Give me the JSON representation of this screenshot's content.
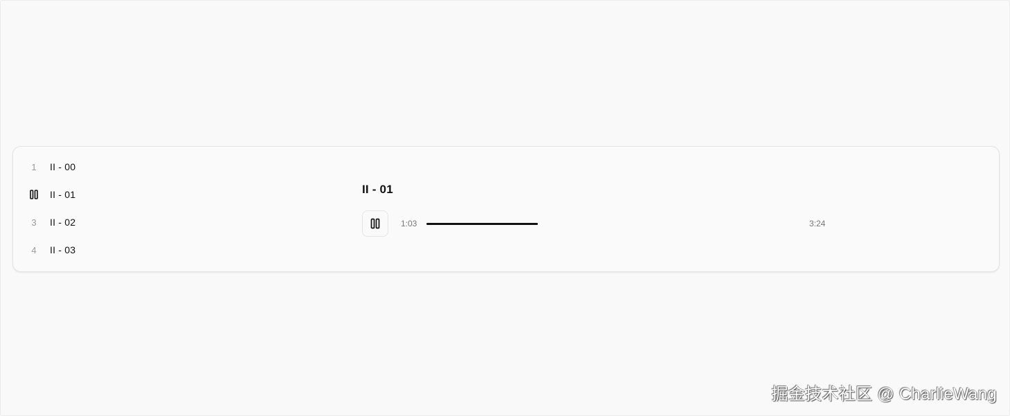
{
  "playlist": {
    "tracks": [
      {
        "number": "1",
        "title": "II - 00",
        "playing": false
      },
      {
        "number": "2",
        "title": "II - 01",
        "playing": true
      },
      {
        "number": "3",
        "title": "II - 02",
        "playing": false
      },
      {
        "number": "4",
        "title": "II - 03",
        "playing": false
      }
    ]
  },
  "now_playing": {
    "title": "II - 01",
    "current_time": "1:03",
    "total_time": "3:24",
    "progress": 0.3088,
    "state": "playing",
    "button_icon": "pause-icon"
  },
  "watermark": {
    "text": "掘金技术社区 @ CharlieWang"
  },
  "colors": {
    "text": "#111111",
    "muted": "#9a9a9a",
    "progress": "#111111",
    "background": "#f9f9f9"
  }
}
